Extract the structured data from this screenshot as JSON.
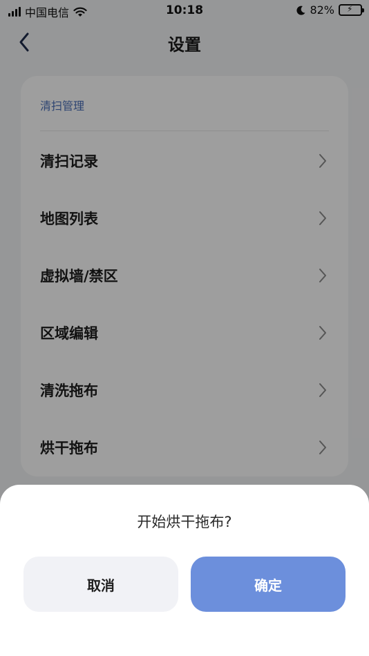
{
  "status_bar": {
    "carrier": "中国电信",
    "time": "10:18",
    "battery": "82%",
    "battery_level": 0.82
  },
  "header": {
    "title": "设置"
  },
  "settings": {
    "section_title": "清扫管理",
    "items": [
      {
        "label": "清扫记录"
      },
      {
        "label": "地图列表"
      },
      {
        "label": "虚拟墙/禁区"
      },
      {
        "label": "区域编辑"
      },
      {
        "label": "清洗拖布"
      },
      {
        "label": "烘干拖布"
      }
    ]
  },
  "dialog": {
    "message": "开始烘干拖布?",
    "cancel_label": "取消",
    "confirm_label": "确定",
    "confirm_color": "#6c8fdc"
  }
}
